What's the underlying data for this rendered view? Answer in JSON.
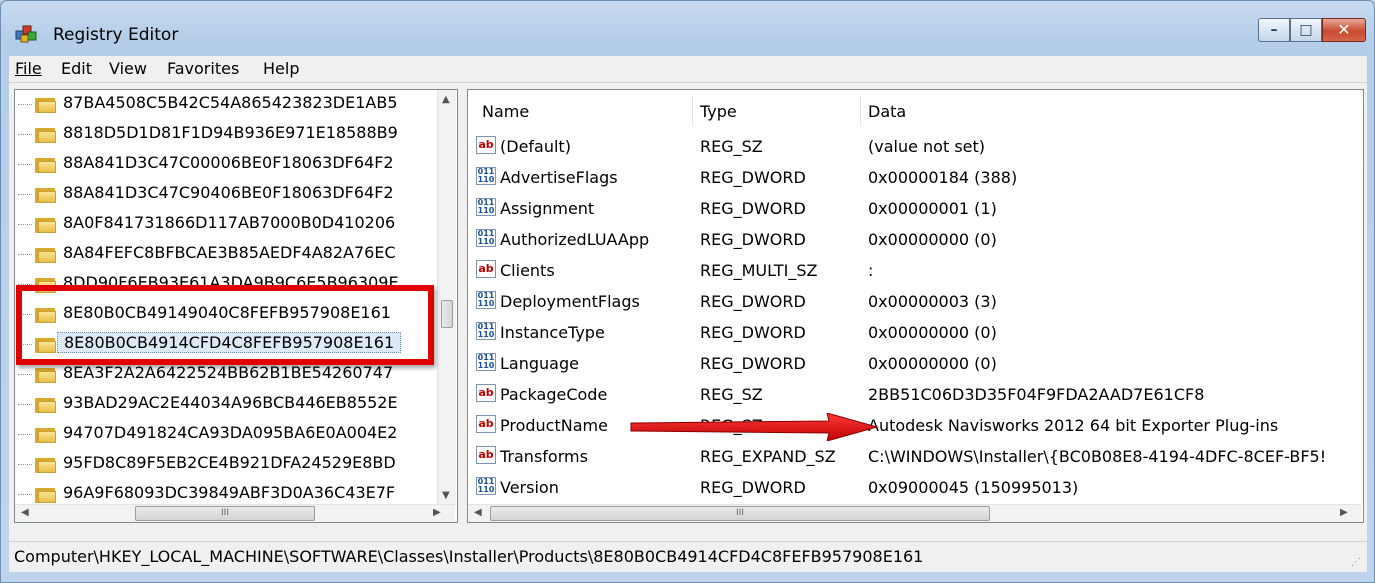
{
  "window": {
    "title": "Registry Editor"
  },
  "menu": [
    "File",
    "Edit",
    "View",
    "Favorites",
    "Help"
  ],
  "tree": {
    "items": [
      "87BA4508C5B42C54A865423823DE1AB5",
      "8818D5D1D81F1D94B936E971E18588B9",
      "88A841D3C47C00006BE0F18063DF64F2",
      "88A841D3C47C90406BE0F18063DF64F2",
      "8A0F841731866D117AB7000B0D410206",
      "8A84FEFC8BFBCAE3B85AEDF4A82A76EC",
      "8DD90F6EB93E61A3DA9B9C6E5B96309E",
      "8E80B0CB49149040C8FEFB957908E161",
      "8E80B0CB4914CFD4C8FEFB957908E161",
      "8EA3F2A2A6422524BB62B1BE54260747",
      "93BAD29AC2E44034A96BCB446EB8552E",
      "94707D491824CA93DA095BA6E0A004E2",
      "95FD8C89F5EB2CE4B921DFA24529E8BD",
      "96A9F68093DC39849ABF3D0A36C43E7F"
    ],
    "selected_index": 8
  },
  "list": {
    "columns": [
      "Name",
      "Type",
      "Data"
    ],
    "rows": [
      {
        "icon": "ab",
        "name": "(Default)",
        "type": "REG_SZ",
        "data": "(value not set)"
      },
      {
        "icon": "bin",
        "name": "AdvertiseFlags",
        "type": "REG_DWORD",
        "data": "0x00000184 (388)"
      },
      {
        "icon": "bin",
        "name": "Assignment",
        "type": "REG_DWORD",
        "data": "0x00000001 (1)"
      },
      {
        "icon": "bin",
        "name": "AuthorizedLUAApp",
        "type": "REG_DWORD",
        "data": "0x00000000 (0)"
      },
      {
        "icon": "ab",
        "name": "Clients",
        "type": "REG_MULTI_SZ",
        "data": ":"
      },
      {
        "icon": "bin",
        "name": "DeploymentFlags",
        "type": "REG_DWORD",
        "data": "0x00000003 (3)"
      },
      {
        "icon": "bin",
        "name": "InstanceType",
        "type": "REG_DWORD",
        "data": "0x00000000 (0)"
      },
      {
        "icon": "bin",
        "name": "Language",
        "type": "REG_DWORD",
        "data": "0x00000000 (0)"
      },
      {
        "icon": "ab",
        "name": "PackageCode",
        "type": "REG_SZ",
        "data": "2BB51C06D3D35F04F9FDA2AAD7E61CF8"
      },
      {
        "icon": "ab",
        "name": "ProductName",
        "type": "REG_SZ",
        "data": "Autodesk Navisworks 2012 64 bit Exporter Plug-ins"
      },
      {
        "icon": "ab",
        "name": "Transforms",
        "type": "REG_EXPAND_SZ",
        "data": "C:\\WINDOWS\\Installer\\{BC0B08E8-4194-4DFC-8CEF-BF5!"
      },
      {
        "icon": "bin",
        "name": "Version",
        "type": "REG_DWORD",
        "data": "0x09000045 (150995013)"
      }
    ]
  },
  "status": "Computer\\HKEY_LOCAL_MACHINE\\SOFTWARE\\Classes\\Installer\\Products\\8E80B0CB4914CFD4C8FEFB957908E161",
  "icons": {
    "app": "registry-cubes-icon",
    "string_value": "ab-string-icon",
    "binary_value": "binary-dword-icon",
    "folder": "folder-icon"
  },
  "colors": {
    "highlight": "#e00000",
    "selection": "#dde9f7"
  }
}
